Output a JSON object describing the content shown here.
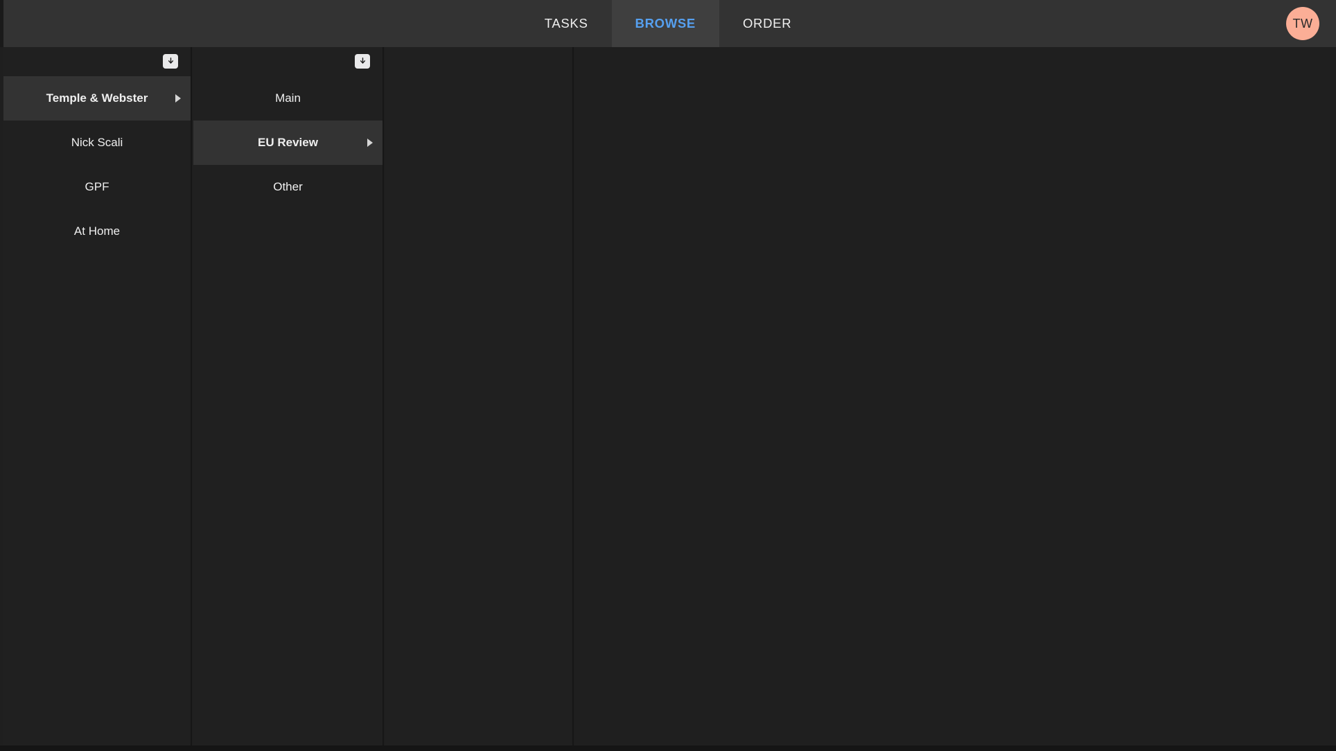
{
  "topbar": {
    "tabs": [
      {
        "label": "TASKS",
        "active": false
      },
      {
        "label": "BROWSE",
        "active": true
      },
      {
        "label": "ORDER",
        "active": false
      }
    ],
    "avatar_initials": "TW",
    "avatar_color": "#fbae96",
    "active_tab_color": "#56a0f0"
  },
  "columns": [
    {
      "name": "accounts-column",
      "collapse_icon": "download-arrow-icon",
      "items": [
        {
          "label": "Temple & Webster",
          "selected": true,
          "has_chevron": true
        },
        {
          "label": "Nick Scali",
          "selected": false,
          "has_chevron": false
        },
        {
          "label": "GPF",
          "selected": false,
          "has_chevron": false
        },
        {
          "label": "At Home",
          "selected": false,
          "has_chevron": false
        }
      ]
    },
    {
      "name": "sections-column",
      "collapse_icon": "download-arrow-icon",
      "items": [
        {
          "label": "Main",
          "selected": false,
          "has_chevron": false
        },
        {
          "label": "EU Review",
          "selected": true,
          "has_chevron": true
        },
        {
          "label": "Other",
          "selected": false,
          "has_chevron": false
        }
      ]
    },
    {
      "name": "detail-column",
      "collapse_icon": null,
      "items": []
    },
    {
      "name": "content-column",
      "collapse_icon": null,
      "items": []
    }
  ]
}
